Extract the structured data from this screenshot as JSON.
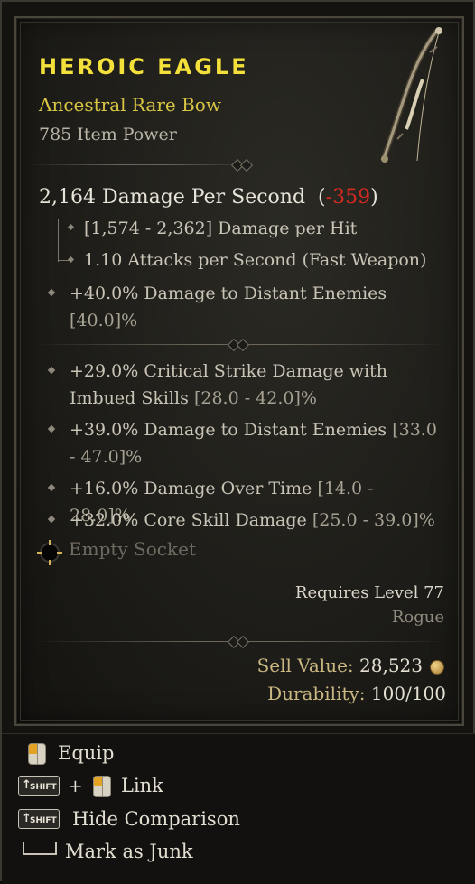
{
  "item": {
    "name": "HEROIC EAGLE",
    "type": "Ancestral Rare Bow",
    "item_power": "785 Item Power",
    "dps": "2,164 Damage Per Second",
    "dps_delta": "-359",
    "damage_per_hit": "[1,574 - 2,362] Damage per Hit",
    "attacks_per_second": "1.10 Attacks per Second (Fast Weapon)",
    "implicit": {
      "value": "+40.0% Damage to Distant Enemies",
      "range": "[40.0]%"
    },
    "affixes": [
      {
        "value": "+29.0% Critical Strike Damage with Imbued Skills",
        "range": "[28.0 - 42.0]%"
      },
      {
        "value": "+39.0% Damage to Distant Enemies",
        "range": "[33.0 - 47.0]%"
      },
      {
        "value": "+16.0% Damage Over Time",
        "range": "[14.0 - 28.0]%"
      },
      {
        "value": "+32.0% Core Skill Damage",
        "range": "[25.0 - 39.0]%"
      }
    ],
    "socket": "Empty Socket",
    "requires_level": "Requires Level 77",
    "class": "Rogue",
    "sell_label": "Sell Value:",
    "sell_value": "28,523",
    "durability_label": "Durability:",
    "durability_value": "100/100"
  },
  "actions": {
    "equip": "Equip",
    "link": "Link",
    "hide_comparison": "Hide Comparison",
    "mark_as_junk": "Mark as Junk",
    "shift_key": "SHIFT",
    "plus": "+"
  },
  "colors": {
    "title": "#f3e03a",
    "subtitle": "#d8c544",
    "negative": "#d02a22"
  },
  "icons": [
    "bow-icon",
    "divider-ornament",
    "bullet-diamond-icon",
    "socket-icon",
    "gold-coin-icon",
    "mouse-left-icon",
    "shift-key-icon",
    "spacebar-icon"
  ]
}
